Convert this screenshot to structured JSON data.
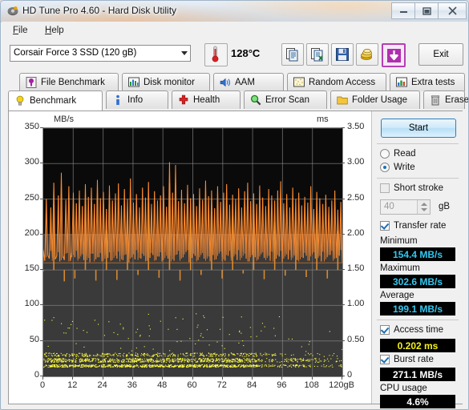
{
  "window": {
    "title": "HD Tune Pro 4.60 - Hard Disk Utility",
    "icon": "hdtune-app-icon",
    "minimize_label": "–",
    "maximize_label": "□",
    "close_label": "✕"
  },
  "menu": [
    {
      "label": "File",
      "accel": "F"
    },
    {
      "label": "Help",
      "accel": "H"
    }
  ],
  "toolbar": {
    "drive": "Corsair Force 3 SSD (120 gB)",
    "drive_icon": "chevron-down-icon",
    "temperature": "128°C",
    "temperature_icon": "thermometer-icon",
    "buttons": [
      {
        "name": "copy-icon",
        "label": ""
      },
      {
        "name": "copy-to-excel-icon",
        "label": ""
      },
      {
        "name": "save-icon",
        "label": ""
      },
      {
        "name": "gold-coins-icon",
        "label": ""
      },
      {
        "name": "download-arrow-icon",
        "label": ""
      }
    ],
    "exit_label": "Exit"
  },
  "tabs_top": [
    {
      "label": "File Benchmark",
      "icon": "file-benchmark-icon"
    },
    {
      "label": "Disk monitor",
      "icon": "disk-monitor-icon"
    },
    {
      "label": "AAM",
      "icon": "speaker-icon"
    },
    {
      "label": "Random Access",
      "icon": "random-access-icon"
    },
    {
      "label": "Extra tests",
      "icon": "extra-tests-icon"
    }
  ],
  "tabs_bottom": [
    {
      "label": "Benchmark",
      "icon": "lightbulb-icon",
      "active": true
    },
    {
      "label": "Info",
      "icon": "info-icon",
      "active": false
    },
    {
      "label": "Health",
      "icon": "health-cross-icon",
      "active": false
    },
    {
      "label": "Error Scan",
      "icon": "magnifier-icon",
      "active": false
    },
    {
      "label": "Folder Usage",
      "icon": "folder-icon",
      "active": false
    },
    {
      "label": "Erase",
      "icon": "trash-icon",
      "active": false
    }
  ],
  "sidebar": {
    "start_label": "Start",
    "mode_read": "Read",
    "mode_write": "Write",
    "mode_selected": "Write",
    "short_stroke_label": "Short stroke",
    "short_stroke_checked": false,
    "short_stroke_value": "40",
    "short_stroke_unit": "gB",
    "transfer_rate_label": "Transfer rate",
    "transfer_rate_checked": true,
    "minimum_label": "Minimum",
    "minimum_value": "154.4 MB/s",
    "maximum_label": "Maximum",
    "maximum_value": "302.6 MB/s",
    "average_label": "Average",
    "average_value": "199.1 MB/s",
    "access_time_label": "Access time",
    "access_time_checked": true,
    "access_time_value": "0.202 ms",
    "burst_rate_label": "Burst rate",
    "burst_rate_checked": true,
    "burst_rate_value": "271.1 MB/s",
    "cpu_usage_label": "CPU usage",
    "cpu_usage_value": "4.6%"
  },
  "colors": {
    "transfer_rate_line": "#ff8c32",
    "access_time_dots": "#ffff40",
    "plot_background_upper": "#0a0a0a",
    "plot_background_lower": "#3a3a3a",
    "value_cyan": "#32c8f0",
    "value_yellow": "#f3f018",
    "accent_purple": "#b43fb4"
  },
  "chart_data": {
    "type": "line",
    "title": "",
    "xlabel": "",
    "ylabel": "MB/s",
    "y2label": "ms",
    "xunit": "gB",
    "xlim": [
      0,
      120
    ],
    "ylim": [
      0,
      350
    ],
    "y2lim": [
      0,
      3.5
    ],
    "grid": true,
    "xticks": [
      0,
      12,
      24,
      36,
      48,
      60,
      72,
      84,
      96,
      108,
      120
    ],
    "xticklabels": [
      "0",
      "12",
      "24",
      "36",
      "48",
      "60",
      "72",
      "84",
      "96",
      "108",
      "120gB"
    ],
    "yticks": [
      0,
      50,
      100,
      150,
      200,
      250,
      300,
      350
    ],
    "yticklabels": [
      "0",
      "50",
      "100",
      "150",
      "200",
      "250",
      "300",
      "350"
    ],
    "y2ticks": [
      0,
      0.5,
      1.0,
      1.5,
      2.0,
      2.5,
      3.0,
      3.5
    ],
    "y2ticklabels": [
      "0",
      "0.50",
      "1.00",
      "1.50",
      "2.00",
      "2.50",
      "3.00",
      "3.50"
    ],
    "series": [
      {
        "name": "Transfer rate",
        "color": "#ff8c32",
        "axis": "left",
        "units": "MB/s",
        "minimum": 154.4,
        "maximum": 302.6,
        "average": 199.1,
        "description": "Dense oscillating write-rate trace spiking between ~155 and ~303 MB/s across the full 120 gB span",
        "values": [
          178,
          163,
          250,
          171,
          166,
          238,
          167,
          273,
          165,
          170,
          255,
          162,
          287,
          170,
          164,
          249,
          174,
          268,
          163,
          175,
          259,
          168,
          244,
          166,
          262,
          171,
          240,
          164,
          271,
          169,
          253,
          161,
          266,
          173,
          243,
          165,
          277,
          168,
          251,
          162,
          260,
          170,
          236,
          167,
          269,
          163,
          248,
          175,
          258,
          166,
          272,
          169,
          241,
          164,
          264,
          172,
          250,
          161,
          279,
          168,
          245,
          165,
          257,
          173,
          238,
          166,
          266,
          170,
          252,
          163,
          274,
          167,
          243,
          171,
          261,
          164,
          248,
          169,
          255,
          162,
          268,
          174,
          239,
          166,
          302,
          170,
          259,
          163,
          298,
          172,
          247,
          165,
          263,
          168,
          244,
          176,
          270,
          161,
          251,
          167,
          257,
          170,
          240,
          164,
          265,
          173,
          249,
          166,
          276,
          169,
          254,
          162,
          262,
          171,
          237,
          165,
          268,
          174,
          246,
          168,
          259,
          163,
          271,
          170,
          242,
          167,
          256,
          172,
          250,
          164,
          265,
          169,
          238,
          175,
          261,
          166,
          273,
          162,
          247,
          171,
          258,
          168,
          243,
          165,
          269,
          173,
          252,
          167,
          240,
          170,
          264,
          163,
          255,
          174,
          248,
          166,
          262,
          169,
          275,
          161,
          244,
          172,
          257,
          165,
          238,
          168,
          266,
          171,
          250,
          164,
          259,
          176,
          241,
          167,
          253,
          170,
          245,
          163,
          268,
          173,
          236,
          166,
          260,
          169,
          251,
          162,
          243,
          174,
          256,
          168,
          239,
          171,
          248,
          165,
          262,
          167,
          235,
          170,
          246,
          160
        ]
      },
      {
        "name": "Access time",
        "color": "#ffff40",
        "axis": "right",
        "units": "ms",
        "average": 0.202,
        "description": "Scatter of access-time samples densely clustered between roughly 0.10 and 0.35 ms, thinning after ~90 gB",
        "range_ms": [
          0.1,
          0.38
        ]
      }
    ]
  }
}
